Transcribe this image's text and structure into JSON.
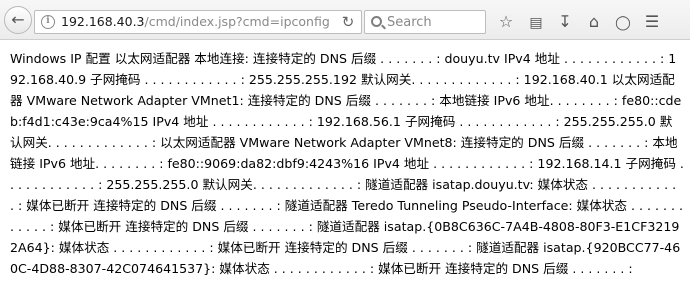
{
  "toolbar": {
    "url_host": "192.168.40.3",
    "url_path": "/cmd/index.jsp?cmd=ipconfig",
    "search_placeholder": "Search"
  },
  "page": {
    "output": "Windows IP 配置 以太网适配器 本地连接: 连接特定的 DNS 后缀 . . . . . . . : douyu.tv IPv4 地址 . . . . . . . . . . . . : 192.168.40.9 子网掩码 . . . . . . . . . . . . : 255.255.255.192 默认网关. . . . . . . . . . . . . : 192.168.40.1 以太网适配器 VMware Network Adapter VMnet1: 连接特定的 DNS 后缀 . . . . . . . : 本地链接 IPv6 地址. . . . . . . . : fe80::cdeb:f4d1:c43e:9ca4%15 IPv4 地址 . . . . . . . . . . . . : 192.168.56.1 子网掩码 . . . . . . . . . . . . : 255.255.255.0 默认网关. . . . . . . . . . . . . : 以太网适配器 VMware Network Adapter VMnet8: 连接特定的 DNS 后缀 . . . . . . . : 本地链接 IPv6 地址. . . . . . . . : fe80::9069:da82:dbf9:4243%16 IPv4 地址 . . . . . . . . . . . . : 192.168.14.1 子网掩码 . . . . . . . . . . . . : 255.255.255.0 默认网关. . . . . . . . . . . . . : 隧道适配器 isatap.douyu.tv: 媒体状态 . . . . . . . . . . . . : 媒体已断开 连接特定的 DNS 后缀 . . . . . . . : 隧道适配器 Teredo Tunneling Pseudo-Interface: 媒体状态 . . . . . . . . . . . . : 媒体已断开 连接特定的 DNS 后缀 . . . . . . . : 隧道适配器 isatap.{0B8C636C-7A4B-4808-80F3-E1CF32192A64}: 媒体状态 . . . . . . . . . . . . : 媒体已断开 连接特定的 DNS 后缀 . . . . . . . : 隧道适配器 isatap.{920BCC77-460C-4D88-8307-42C074641537}: 媒体状态 . . . . . . . . . . . . : 媒体已断开 连接特定的 DNS 后缀 . . . . . . . :"
  }
}
